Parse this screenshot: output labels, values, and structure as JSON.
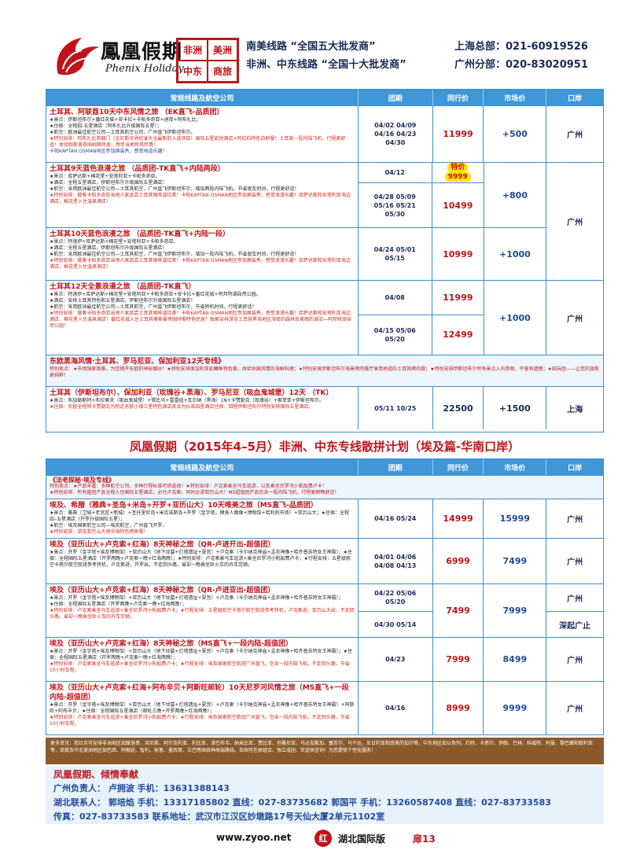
{
  "header": {
    "brand_cn": "鳳凰假期",
    "brand_en": "Phenix Holiday",
    "stamp": [
      "非洲",
      "美洲",
      "中东",
      "商旅"
    ],
    "slogan_1": "南美线路 “全国五大批发商”",
    "slogan_2": "非洲、中东线路 “全国十大批发商”",
    "hq_1": "上海总部：021-60919526",
    "hq_2": "广州分部：020-83020951"
  },
  "table_headers": [
    "常规线路及航空公司",
    "团期",
    "同行价",
    "市场价",
    "口岸"
  ],
  "turkey_rows": [
    {
      "title": "土耳其、阿联酋10天中东风情之旅    （EK直飞-品质团）",
      "lines": [
        "★景点：伊斯坦布尔+番红花城+安卡拉+卡帕多奇亚+迪拜+阿布扎比；",
        "★住宿：全程四-五星酒店（阿布扎比升级国际五星）；",
        "★航空：欧洲最佳航空公司—土耳其航空公司，广州直飞伊斯坦布尔。"
      ],
      "red": "★特别安排：阿布扎比首都门（吉尼斯世界纪录大全最新的入选项目）国际五星凯悦酒店+阿拉伯特色自助餐！土耳其一段内陆飞机，行程更舒适！体验跑斯普奇国树腾民居，感受当地民风民情！",
      "blue": "卡帕KAPTAN OSMAN地区参加换装秀，感受地道乐趣！",
      "dates": [
        "04/02  04/09",
        "04/16  04/23",
        "04/30"
      ],
      "price": "11999",
      "market": "+500",
      "port": "广州"
    },
    {
      "title": "土耳其9天蓝色浪漫之旅      （品质团-TK直飞+内陆两段）",
      "lines": [
        "★景点：库萨达斯+棉花堡+安塔利亚+卡帕多奇亚。",
        "★酒店：全程五星酒店，伊斯坦布尔升级国际五星酒店！",
        "★航空：采用欧洲最佳航空公司—土耳其航空，广州直飞伊斯坦布尔，增加两段内陆飞机，节省驱车时间，行程更舒适！"
      ],
      "red": "★特别安排：做客卡帕多奇亚当地人家品尝土耳其咖啡或红茶！卡帕KAPTAN OSMAN地区参加换装秀，感受浪漫乐趣！库萨达斯和安塔利亚海边酒店，棉花堡入住温泉酒店！",
      "dates_a": [
        "04/12"
      ],
      "badge_1": "特价",
      "badge_2": "9999",
      "dates_b": [
        "04/28  05/09",
        "05/16  05/21",
        "05/30"
      ],
      "price": "10499",
      "market": "+800",
      "port": "广州"
    },
    {
      "title": "土耳其10天蓝色浪漫之旅      （品质团-TK直飞+内陆一段）",
      "lines": [
        "★景点：特洛伊+库萨达斯+棉花堡+安塔利亚+卡帕多奇亚。",
        "★酒店：全程五星酒店，伊斯坦布尔升级国际五星酒店！",
        "★航空：采用欧洲最佳航空公司—土耳其航空，广州直飞伊斯坦布尔，增加一段内陆飞机，节省驱车时间，行程更舒适！"
      ],
      "red": "★特别安排：做客卡帕多奇亚当地人家品尝土耳其咖啡或红茶！卡帕KAPTAN OSMAN地区参加换装秀，感受浪漫乐趣！库萨达斯和安塔利亚海边酒店，棉花堡入住温泉酒店！",
      "dates": [
        "04/24  05/01",
        "05/15"
      ],
      "price": "10999",
      "market": "+1000",
      "port": "广州"
    },
    {
      "title": "土耳其12天全景浪漫之旅      （品质团-TK直飞）",
      "lines": [
        "★景点：特洛伊+库萨达斯+棉花堡+安塔利亚+卡帕多奇亚+安卡拉+番红花城+阿邦特湖自然公园。",
        "★酒店：安排土耳其特色和五星酒店，伊斯坦布尔升级国际五星酒店！",
        "★航空：采用欧洲最佳航空公司—土耳其航空，广州直飞伊斯坦布尔，节省转机时间，行程更舒适！"
      ],
      "red": "★特别安排：做客卡帕多奇亚当地人家品尝土耳其咖啡或红茶！卡帕KAPTAN OSMAN地区参加换装秀，感受浪漫乐趣！库萨达斯和安塔利亚海边酒店，棉花堡入住温泉酒店！番红花城入住土耳其奥斯曼帝国时期特色民居！独家安排游览土耳其黑海地区茂密的森林及美丽的湖泊—阿邦特湖自然公园！",
      "dates_a": [
        "04/08"
      ],
      "price_a": "11999",
      "dates_b": [
        "04/15  05/06",
        "05/20"
      ],
      "price_b": "12499",
      "market": "+1000",
      "port": "广州"
    }
  ],
  "balkan": {
    "title": "东欧黑海风情·土耳其、罗马尼亚、保加利亚12天专线》",
    "line": "特别卖点：★市场独家首推，为您揭开东欧的神秘面纱！★特别安排保加利亚虹鳟鱼特色餐，体验异国风情的海鲜料理；★特别安排伊斯坦布尔海景烤肉餐厅享用地道的土耳其烤肉餐；★特别安排伊斯坦布尔所有景点入内参观，不留有遗憾；★纯玩团——让您的旅程更纯粹！",
    "title2": "土耳其（伊斯坦布尔）、保加利亚（玫瑰谷+黑海）、罗马尼亚（吸血鬼城堡）12天  （TK）",
    "lines": [
      "★景点：布加勒斯特+布拉索夫（吸血鬼城堡）+锡比乌+雷雷纽+瓦尔纳（黑海）1N+卡赞勒克（玫瑰谷）+索菲亚+伊斯坦布尔。"
    ],
    "red": "★住宿：东欧全程除卡赞勒克为附近东欧小镇三星特色酒店其余为标准四星酒店住宿，回程伊斯坦布尔特别安排国际五星酒店。",
    "dates": [
      "05/11  10/25"
    ],
    "price": "22500",
    "market": "+1500",
    "port": "上海"
  },
  "banner": "凤凰假期（2015年4–5月）非洲、中东专线散拼计划（埃及篇-华南口岸）",
  "egypt_intro": {
    "title": "《法老探秘·埃及专线》",
    "l1": "特别卖点：★产品丰富：多种航空公司、多种行程标准可供选择！★特别安排：卢克索乘坐马车巡游，以及乘坐尼罗河小帆船费卢卡！",
    "l2": "★特别安排：所有越团产品全程入住国际五星酒店，必住卢克索，同时必游亚历山大！MS超值团产品包含一段内陆飞机，行程更顺畅舒适！"
  },
  "egypt_rows": [
    {
      "title": "埃及、希腊（雅典+圣岛+米岛+开罗+亚历山大）10天唯美之旅（MS直飞-品质团）",
      "lines": [
        "★景点：雅典（卫城+老宫区+新城）+圣托里尼岛+米克诺斯岛+开罗（金字塔，狮身人面像+博物馆+哈利利市场）+亚历山大；★住宿：全程四–五星酒店（开罗升级国际五星）；",
        "★航空：埃及国家航空公司—埃及航空，广州直飞开罗。"
      ],
      "red": "★特别安排：游览亚历山大地中海特色烤鱼餐！",
      "dates": [
        "04/16  05/24"
      ],
      "price": "14999",
      "market": "15999",
      "port": "广州"
    },
    {
      "title": "埃及（亚历山大+卢克索+红海）8天神秘之旅（QR-卢进开出-超值团）",
      "lines": [
        "★景点：开罗（金字塔+埃及博物馆）+亚历山大（地下坟墓+灯塔遗址+夏宫）+卢克索（卡尔纳克神庙+孟农神像+哈齐普苏特女王神殿）；★住宿：全程国际五星酒店（开罗两晚+卢克索一晚+红海两晚）；★特别安排：卢克索乘马车巡游+乘坐尼罗河小帆船费卢卡；★行程安排：五星级航空卡塔尔航空航班参考转机，卢克索进，开罗出，不走回头路，省却一晚乘坐卧火车的舟车劳顿。"
      ],
      "red": "",
      "dates": [
        "04/01  04/06",
        "04/08  04/13"
      ],
      "price": "6999",
      "market": "7499",
      "port": "广州"
    },
    {
      "title": "埃及（亚历山大+卢克索+红海）8天神秘之旅（QR-卢进亚出-超值团）",
      "lines": [
        "★景点：开罗（金字塔+埃及博物馆）+亚历山大（地下坟墓+灯塔遗址+夏宫）+卢克索（卡尔纳克神庙+孟农神像+哈齐普苏特女王神殿）；",
        "★住宿：全程国际五星酒店（开罗两晚+卢克索一晚+红海两晚）；"
      ],
      "red": "★特别安排：卢克索乘坐马车巡游+乘坐尼罗河小帆船费卢卡；★行程安排：五星级航空卡塔尔航空航班参考转机，卢克索进，亚历山大出，不走回头路，省却一晚乘坐卧火车的舟车劳顿。",
      "dates_a": [
        "04/22  05/06",
        "05/20"
      ],
      "port_a": "广州",
      "dates_b": [
        "04/30  05/14"
      ],
      "port_b": "深起广止",
      "price": "7499",
      "market": "7999"
    },
    {
      "title": "埃及（亚历山大+卢克索+红海）8天神秘之旅（MS直飞+一段内陆-超值团）",
      "lines": [
        "★景点：开罗（金字塔+埃及博物馆）+亚历山大（地下坟墓+灯塔遗址+夏宫）+卢克索（卡尔纳克神庙+孟农神像+哈齐普苏特女王神殿）；★住宿：全程国际五星酒店（开罗两晚+卢克索一晚+红海两晚）；"
      ],
      "red": "★特别安排：卢克索乘坐马车巡游+乘坐尼罗河小帆船费卢卡；★行程安排：埃及国家航空航班广州直飞，包含一段内陆飞机，不走回头路，节省10小时车程。",
      "dates": [
        "04/23"
      ],
      "price": "7999",
      "market": "8499",
      "port": "广州"
    },
    {
      "title": "埃及（亚历山大+卢克索+红海+阿布辛贝+阿斯旺邮轮）10天尼罗河风情之旅（MS直飞+一段内陆-超值团）",
      "lines": [
        "★景点：开罗（金字塔+埃及博物馆）+亚历山大（地下坟墓+灯塔遗址+夏宫）+卢克索（卡尔纳克神庙+孟农神像+哈齐普苏特女王神殿）+阿斯旺+阿布辛贝；★住宿：全程国际五星酒店（邮轮三晚+开罗两晚+红海两晚）；"
      ],
      "red": "★特别安排：卢克索乘坐马车巡游+乘坐尼罗河小帆船费卢卡；★行程安排：埃及国家航空航班广州直飞，包含一段内陆飞机，不走回头路，节省10小时车程。",
      "dates": [
        "04/16"
      ],
      "price": "8999",
      "market": "9999",
      "port": "广州"
    }
  ],
  "more_routes": "更多资讯：我社另可安排非洲地区如摩洛哥、突尼斯、阿尔及利亚、利比亚、津巴布韦、纳米比亚、赞比亚、坦桑尼亚、马达加斯加、塞舌尔、乌干达、尼日利亚和南美的加尔等，中东地区如以色列、约特、卡塔尔、伊朗、巴林、科威特、阿曼、黎巴嫩和叙利亚等，南美及中北美洲地区如巴西、阿根廷、智利、秘鲁、墨西哥、古巴等国各种高端路线。各国可在原组合、独立成团、欢迎来咨询！为您提供个性化服务！",
  "footer": {
    "title": "凤凰假期、倾情奉献",
    "l1": "广州负责人：  卢拥波  手机：13631388143",
    "l2": "湖北联系人：  郭培焰  手机：13317185802  直线：027-83735682    郭国平  手机：13260587408  直线：027-83733583",
    "l3": "传真：027-83733583        联系地址：武汉市江汉区妙墩路17号天仙大厦2单元1102室"
  },
  "bottom": {
    "site": "www.zyoo.net",
    "logo": "红",
    "label": "湖北国际版",
    "page": "扉13"
  }
}
